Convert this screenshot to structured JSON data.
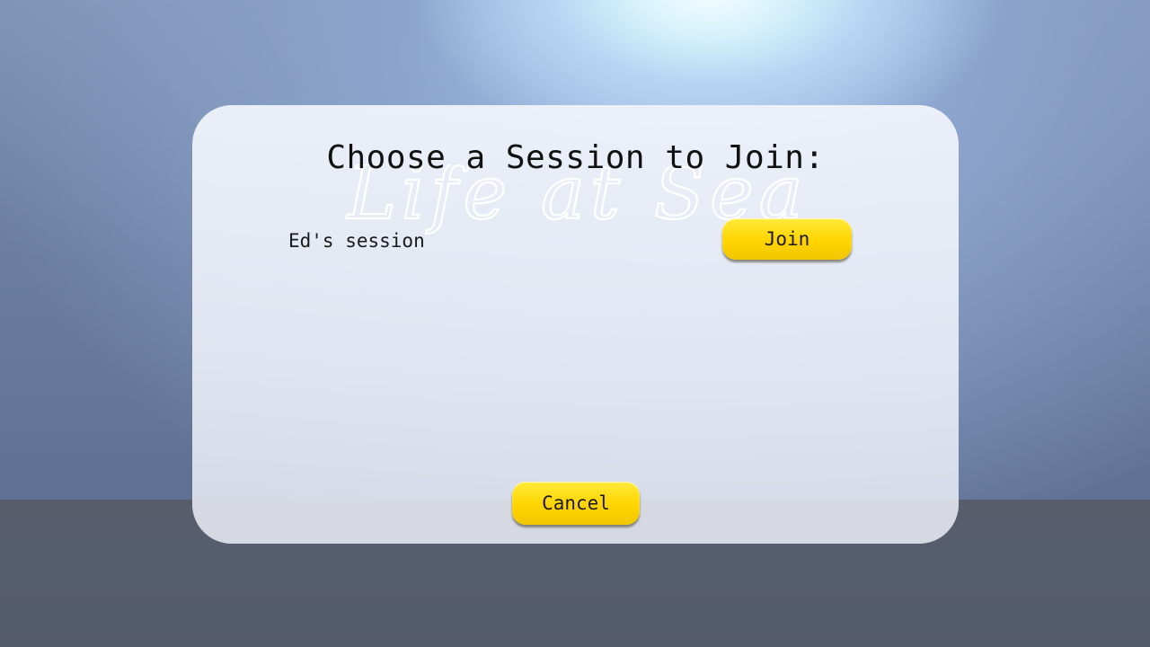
{
  "dialog": {
    "title": "Choose a Session to Join:",
    "logo_text": "Life at Sea"
  },
  "sessions": [
    {
      "name": "Ed's session",
      "join_label": "Join"
    }
  ],
  "actions": {
    "cancel_label": "Cancel"
  },
  "colors": {
    "button_yellow": "#ffd400",
    "panel_bg": "#e8ecf6",
    "ground": "#565d6d",
    "sky": "#8ca4cc"
  }
}
